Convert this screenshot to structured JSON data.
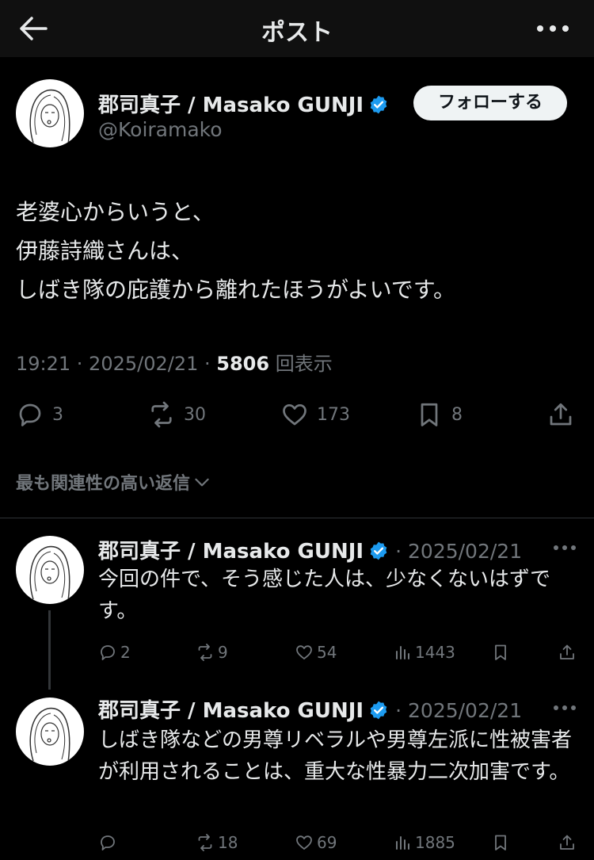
{
  "header": {
    "title": "ポスト"
  },
  "post": {
    "author_name": "郡司真子 / Masako GUNJI",
    "handle": "@Koiramako",
    "follow_label": "フォローする",
    "lines": [
      "老婆心からいうと、",
      "伊藤詩織さんは、",
      "しばき隊の庇護から離れたほうがよいです。"
    ],
    "time": "19:21 · 2025/02/21 · ",
    "views": "5806",
    "views_label": " 回表示",
    "replies": "3",
    "reposts": "30",
    "likes": "173",
    "bookmarks": "8"
  },
  "sort_label": "最も関連性の高い返信",
  "replies": [
    {
      "author_name": "郡司真子 / Masako GUNJI",
      "date": "· 2025/02/21",
      "text": "今回の件で、そう感じた人は、少なくないはずです。",
      "replies": "2",
      "reposts": "9",
      "likes": "54",
      "views": "1443"
    },
    {
      "author_name": "郡司真子 / Masako GUNJI",
      "date": "· 2025/02/21",
      "text": "しばき隊などの男尊リベラルや男尊左派に性被害者が利用されることは、重大な性暴力二次加害です。",
      "replies": "",
      "reposts": "18",
      "likes": "69",
      "views": "1885"
    }
  ],
  "colors": {
    "background": "#000000",
    "text": "#e7e9ea",
    "muted": "#71767b",
    "verified": "#1d9bf0"
  }
}
